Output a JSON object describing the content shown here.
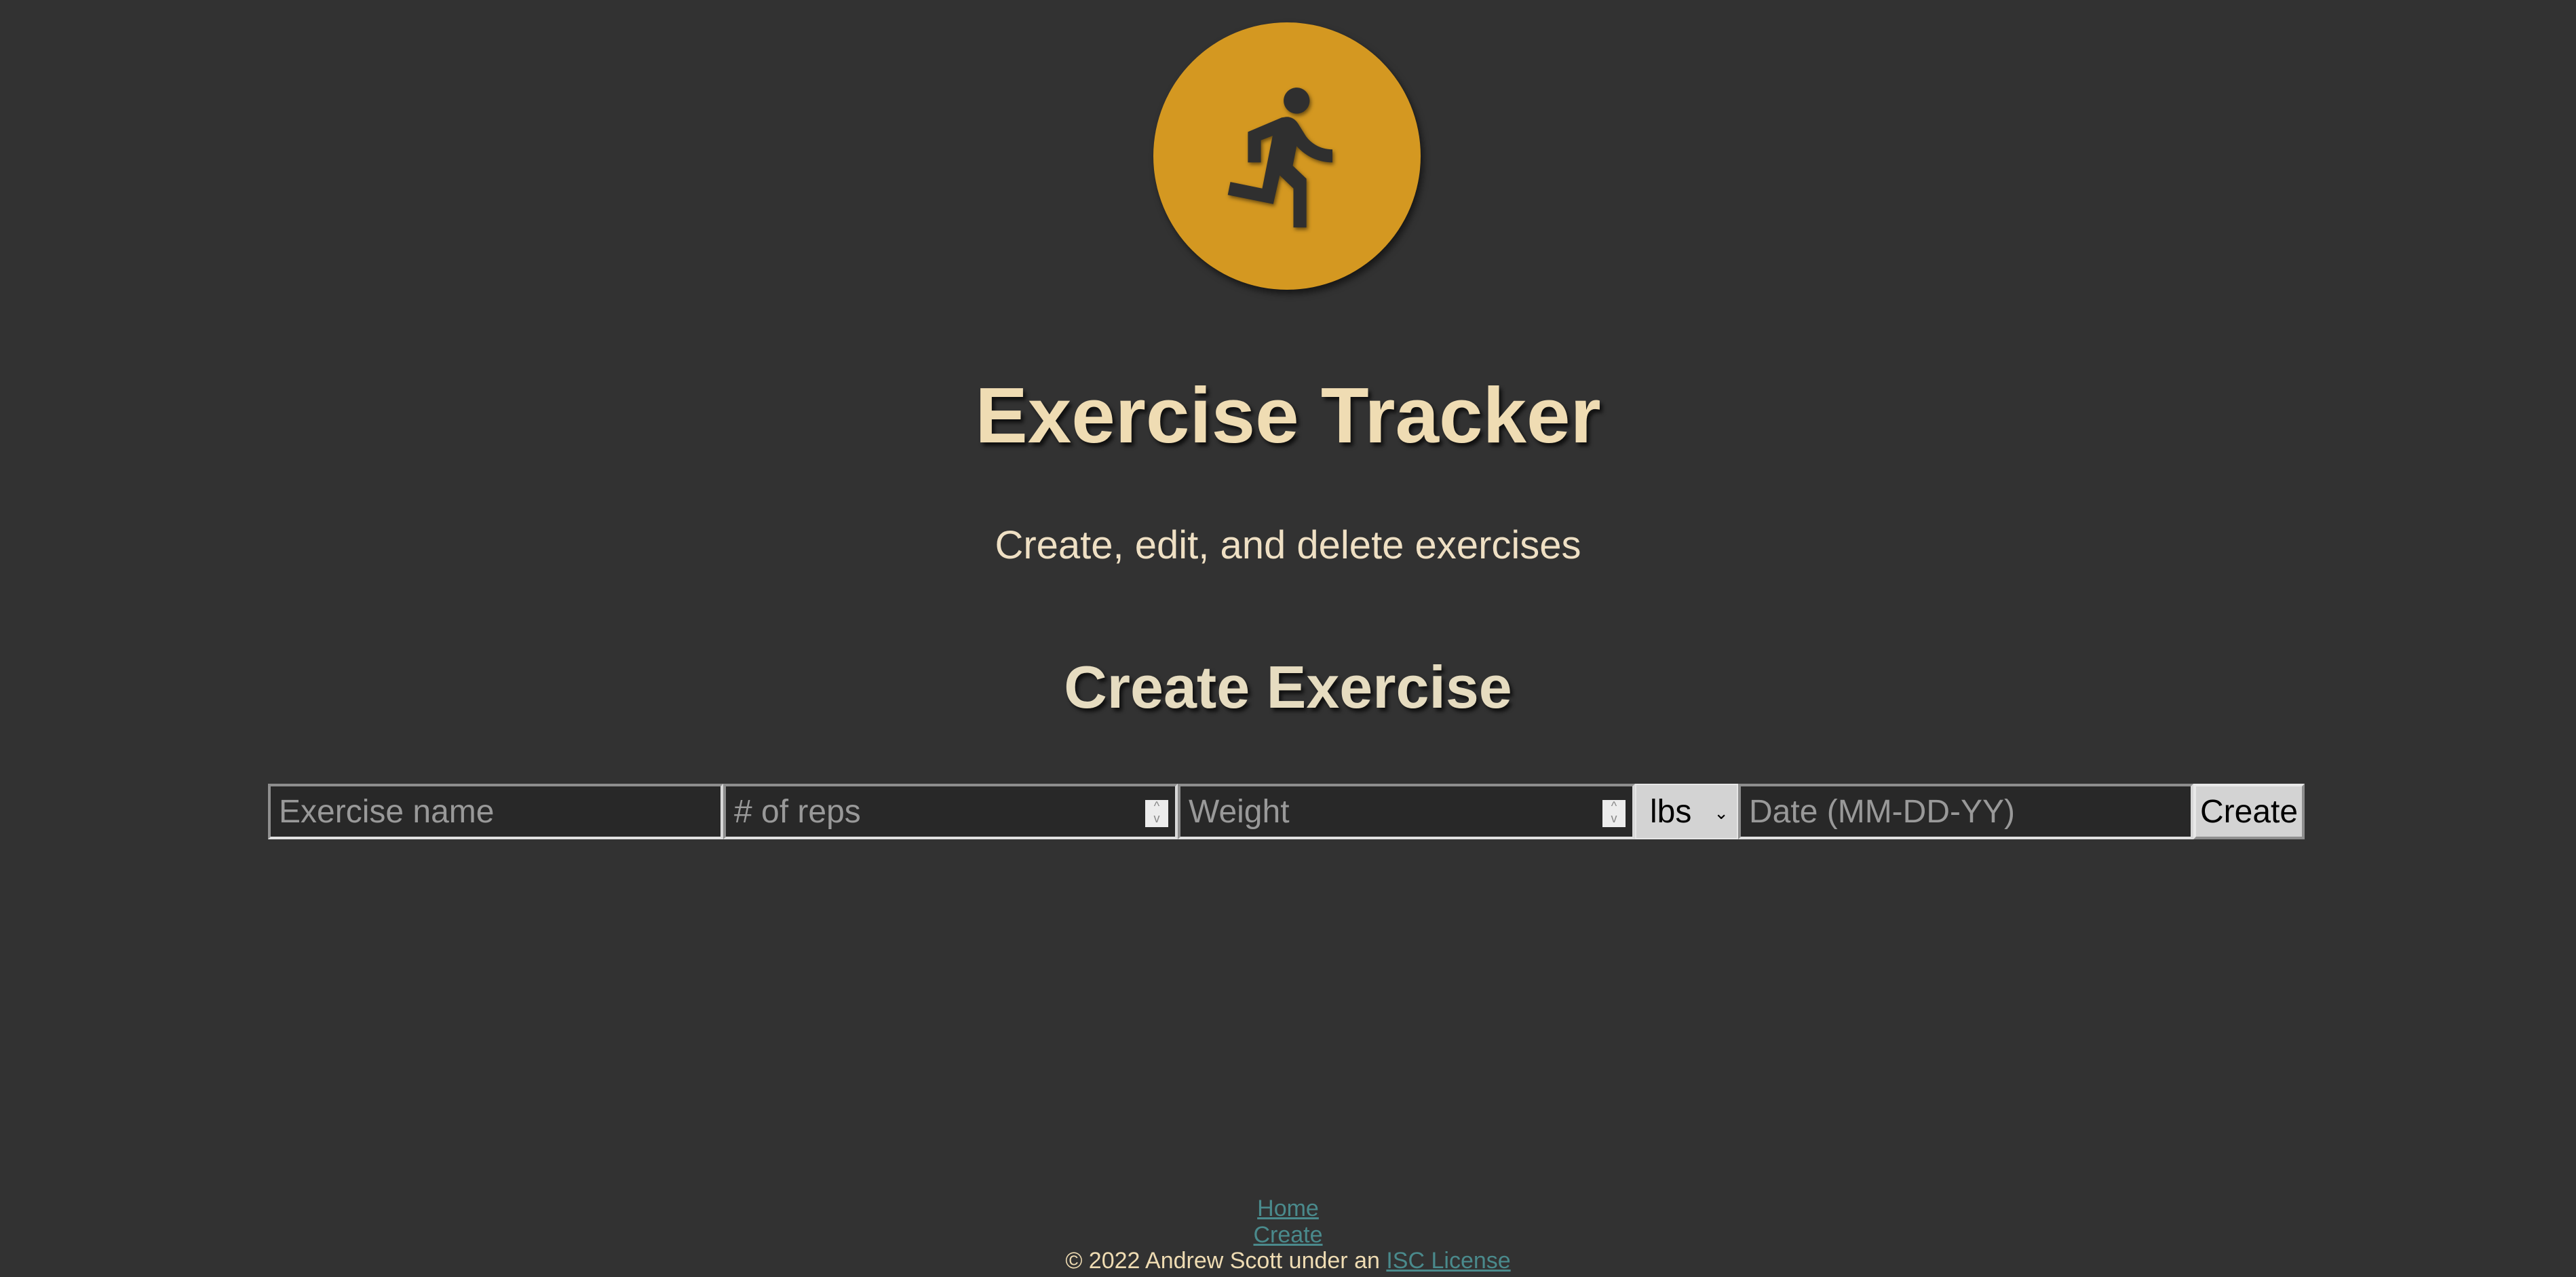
{
  "header": {
    "logo_icon": "running-person-icon",
    "title": "Exercise Tracker",
    "subtitle": "Create, edit, and delete exercises"
  },
  "form": {
    "heading": "Create Exercise",
    "name_placeholder": "Exercise name",
    "reps_placeholder": "# of reps",
    "weight_placeholder": "Weight",
    "unit_selected": "lbs",
    "date_placeholder": "Date (MM-DD-YY)",
    "submit_label": "Create"
  },
  "footer": {
    "nav": [
      "Home",
      "Create"
    ],
    "copyright": "© 2022 Andrew Scott under an",
    "license_link": "ISC License"
  },
  "colors": {
    "background": "#323232",
    "accent": "#d49821",
    "title": "#efdcb3",
    "link": "#4a8a8c"
  }
}
